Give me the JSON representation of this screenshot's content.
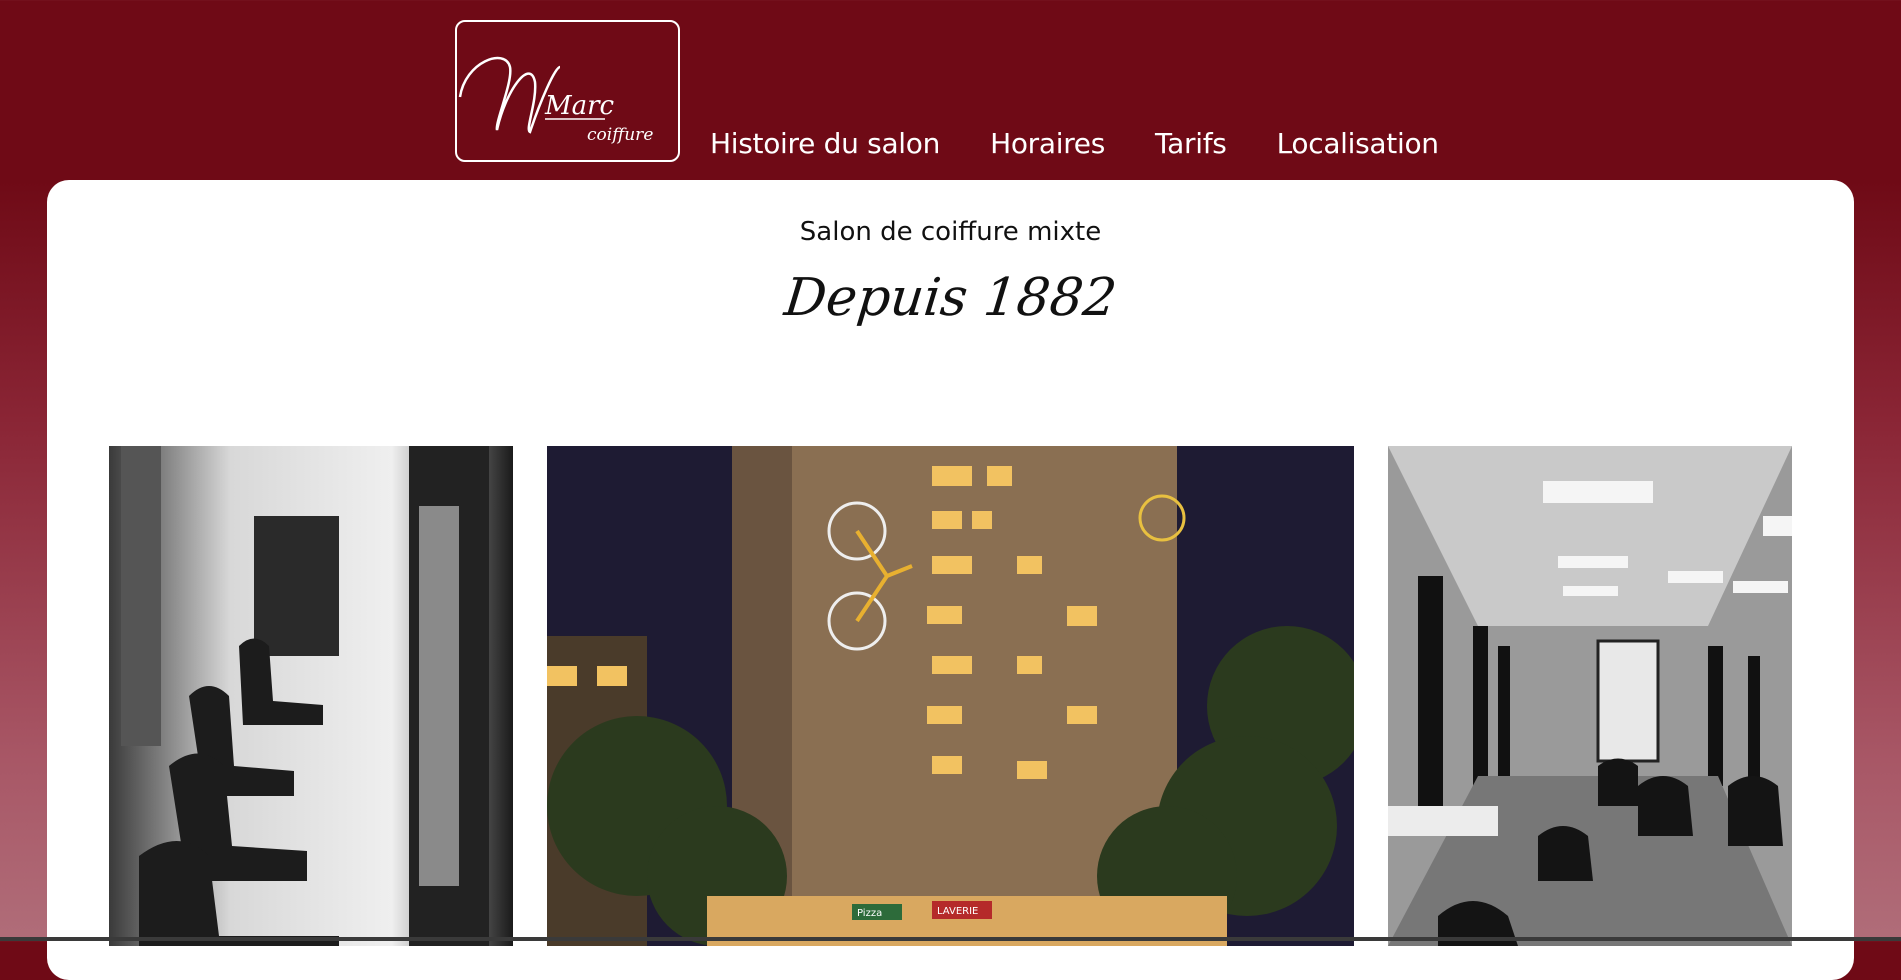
{
  "header": {
    "logo": {
      "script_text": "Marc",
      "sub_text": "coiffure"
    },
    "nav": [
      {
        "label": "Histoire du salon"
      },
      {
        "label": "Horaires"
      },
      {
        "label": "Tarifs"
      },
      {
        "label": "Localisation"
      }
    ]
  },
  "main": {
    "subtitle": "Salon de coiffure mixte",
    "tagline": "Depuis 1882",
    "gallery": [
      {
        "description_icon": "salon-interior-vintage-photo"
      },
      {
        "description_icon": "building-night-photo",
        "shop_signs": [
          "LAVERIE",
          "Pizza"
        ]
      },
      {
        "description_icon": "salon-interior-modern-photo"
      }
    ]
  },
  "colors": {
    "brand": "#6f0a16",
    "card": "#ffffff",
    "text": "#111111"
  }
}
